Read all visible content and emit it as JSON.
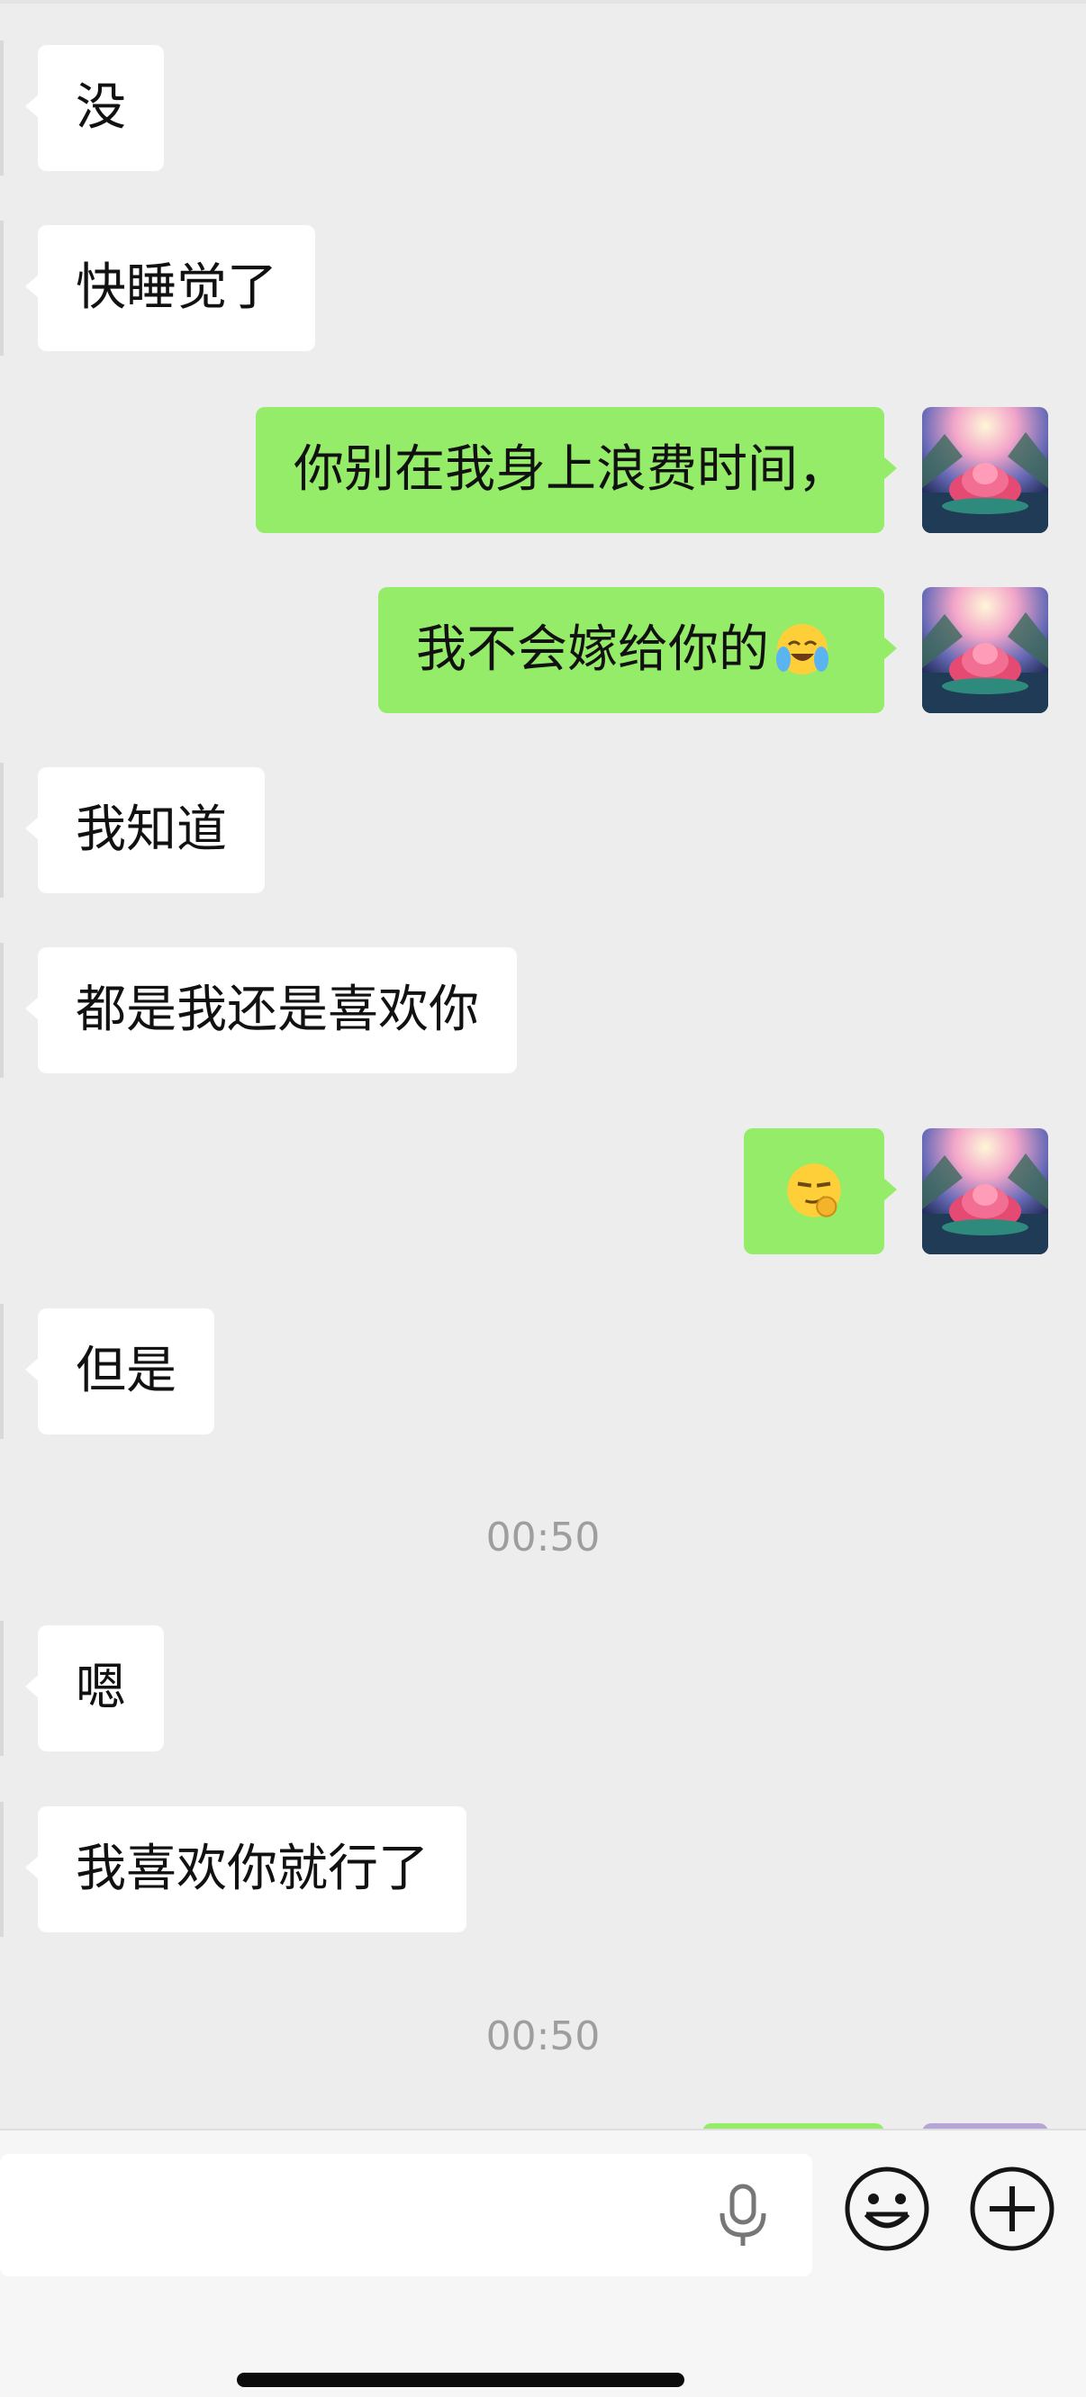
{
  "messages": [
    {
      "side": "in",
      "text": "没"
    },
    {
      "side": "in",
      "text": "快睡觉了"
    },
    {
      "side": "out",
      "text": "你别在我身上浪费时间，"
    },
    {
      "side": "out",
      "text": "我不会嫁给你的",
      "emoji": "face-with-tears-of-joy-icon"
    },
    {
      "side": "in",
      "text": "我知道"
    },
    {
      "side": "in",
      "text": "都是我还是喜欢你"
    },
    {
      "side": "out",
      "text": "",
      "emoji": "smirking-face-with-hand-icon"
    },
    {
      "side": "in",
      "text": "但是"
    },
    {
      "side": "in",
      "text": "嗯"
    },
    {
      "side": "in",
      "text": "我喜欢你就行了"
    }
  ],
  "timestamps": [
    "00:50",
    "00:50"
  ],
  "input": {
    "placeholder": "",
    "icons": [
      "microphone-icon",
      "emoji-icon",
      "plus-icon"
    ]
  },
  "colors": {
    "background": "#ededed",
    "incoming": "#ffffff",
    "outgoing": "#95ec69",
    "timestamp": "#9e9e9e"
  }
}
